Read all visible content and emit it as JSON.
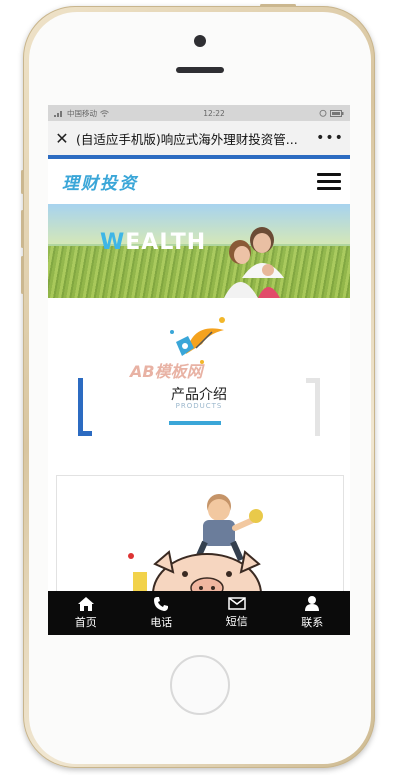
{
  "status_bar": {
    "carrier": "中国移动",
    "time": "12:22"
  },
  "browser": {
    "page_title": "(自适应手机版)响应式海外理财投资管...",
    "close_icon": "close-icon",
    "more_icon": "more-dots-icon"
  },
  "site": {
    "logo_text": "理财投资",
    "menu_icon": "hamburger-menu-icon"
  },
  "banner": {
    "word_part1": "W",
    "word_part2": "EALTH"
  },
  "section": {
    "title": "产品介绍",
    "subtitle": "PRODUCTS"
  },
  "watermark": {
    "text": "AB模板网"
  },
  "tabbar": {
    "items": [
      {
        "label": "首页",
        "icon": "home-icon"
      },
      {
        "label": "电话",
        "icon": "phone-icon"
      },
      {
        "label": "短信",
        "icon": "mail-icon"
      },
      {
        "label": "联系",
        "icon": "user-icon"
      }
    ]
  },
  "colors": {
    "accent_blue": "#2c6bc1",
    "logo_blue": "#3aa6d8",
    "tabbar_bg": "#0b0b0b"
  }
}
